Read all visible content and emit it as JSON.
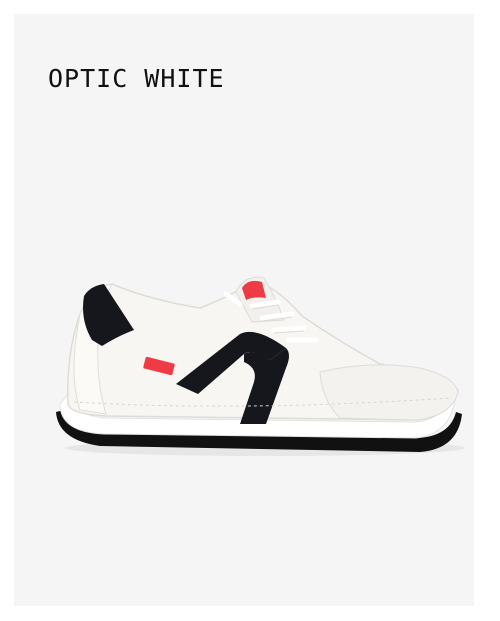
{
  "product": {
    "color_name": "OPTIC WHITE"
  },
  "colors": {
    "background": "#f5f5f5",
    "shoe_body": "#f7f6f2",
    "stripe": "#15171d",
    "accent": "#ee3b45",
    "outsole": "#111111"
  },
  "icons": {
    "product_image": "sneaker-image"
  }
}
